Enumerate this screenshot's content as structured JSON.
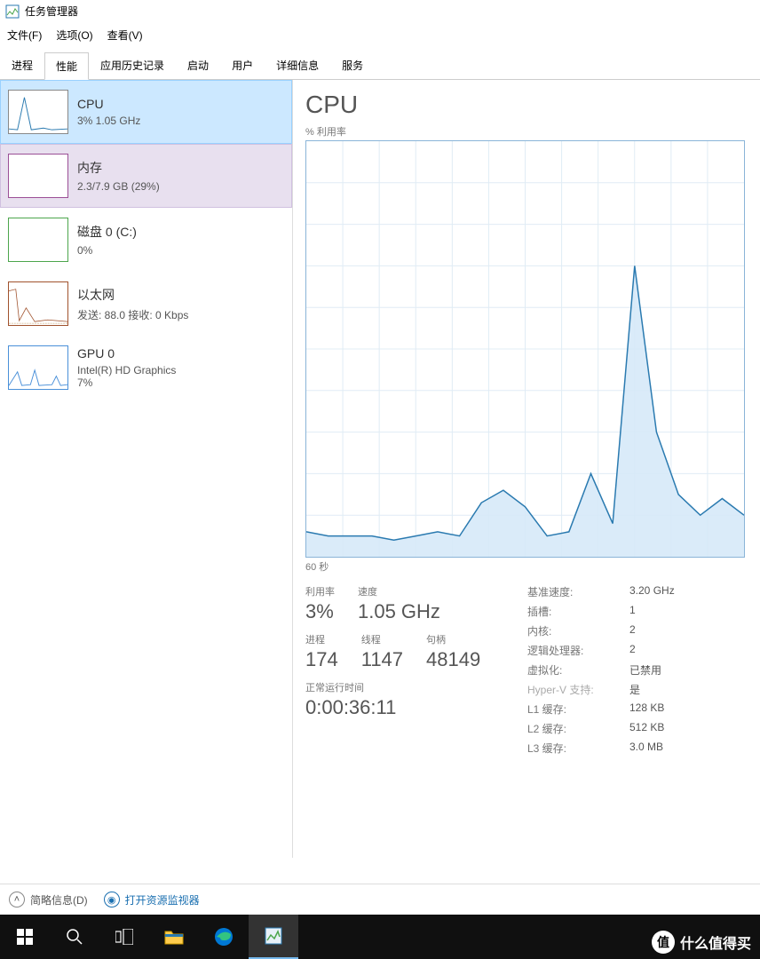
{
  "window": {
    "title": "任务管理器"
  },
  "menu": {
    "file": "文件(F)",
    "options": "选项(O)",
    "view": "查看(V)"
  },
  "tabs": {
    "processes": "进程",
    "performance": "性能",
    "history": "应用历史记录",
    "startup": "启动",
    "users": "用户",
    "details": "详细信息",
    "services": "服务"
  },
  "sidebar": {
    "cpu": {
      "title": "CPU",
      "sub": "3%  1.05 GHz"
    },
    "mem": {
      "title": "内存",
      "sub": "2.3/7.9 GB (29%)"
    },
    "disk": {
      "title": "磁盘 0 (C:)",
      "sub": "0%"
    },
    "net": {
      "title": "以太网",
      "sub": "发送: 88.0  接收: 0 Kbps"
    },
    "gpu": {
      "title": "GPU 0",
      "sub1": "Intel(R) HD Graphics",
      "sub2": "7%"
    }
  },
  "main": {
    "heading": "CPU",
    "chart_y_label": "% 利用率",
    "chart_x_label": "60 秒",
    "stats": {
      "util_label": "利用率",
      "util_val": "3%",
      "speed_label": "速度",
      "speed_val": "1.05 GHz",
      "proc_label": "进程",
      "proc_val": "174",
      "thread_label": "线程",
      "thread_val": "1147",
      "handle_label": "句柄",
      "handle_val": "48149",
      "uptime_label": "正常运行时间",
      "uptime_val": "0:00:36:11"
    },
    "specs": {
      "base_label": "基准速度:",
      "base_val": "3.20 GHz",
      "sockets_label": "插槽:",
      "sockets_val": "1",
      "cores_label": "内核:",
      "cores_val": "2",
      "lproc_label": "逻辑处理器:",
      "lproc_val": "2",
      "virt_label": "虚拟化:",
      "virt_val": "已禁用",
      "hyperv_label": "Hyper-V 支持:",
      "hyperv_val": "是",
      "l1_label": "L1 缓存:",
      "l1_val": "128 KB",
      "l2_label": "L2 缓存:",
      "l2_val": "512 KB",
      "l3_label": "L3 缓存:",
      "l3_val": "3.0 MB"
    }
  },
  "footer": {
    "fewer": "简略信息(D)",
    "resmon": "打开资源监视器"
  },
  "watermark": {
    "text": "什么值得买",
    "logo": "值"
  },
  "chart_data": {
    "type": "area",
    "title": "CPU % 利用率",
    "xlabel": "60 秒",
    "ylabel": "% 利用率",
    "ylim": [
      0,
      100
    ],
    "x_seconds": [
      60,
      57,
      54,
      51,
      48,
      45,
      42,
      39,
      36,
      33,
      30,
      27,
      24,
      21,
      18,
      15,
      12,
      9,
      6,
      3,
      0
    ],
    "values": [
      6,
      5,
      5,
      5,
      4,
      5,
      6,
      5,
      13,
      16,
      12,
      5,
      6,
      20,
      8,
      70,
      30,
      15,
      10,
      14,
      10
    ]
  }
}
